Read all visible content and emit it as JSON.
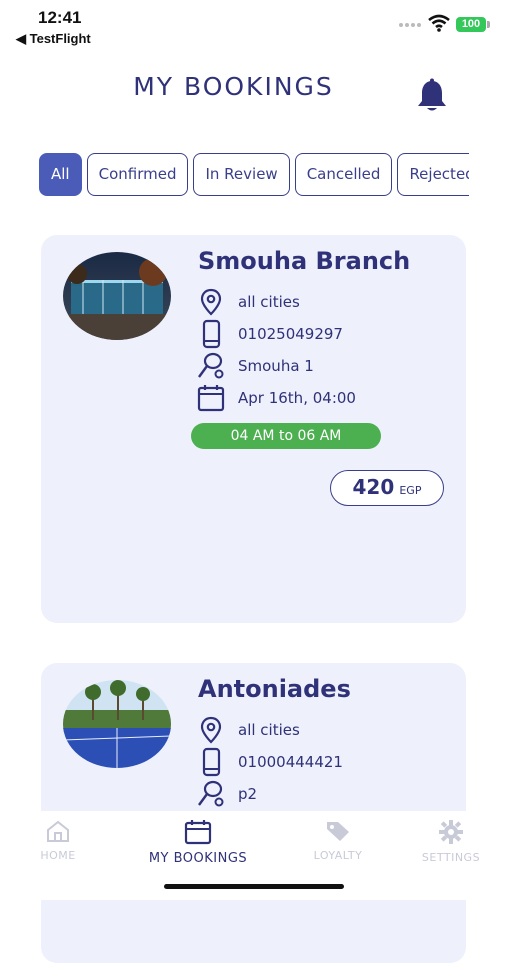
{
  "status_bar": {
    "time": "12:41",
    "back_app": "◀ TestFlight",
    "battery": "100"
  },
  "header": {
    "title": "MY BOOKINGS",
    "bell_icon": "bell-icon"
  },
  "tabs": [
    {
      "label": "All",
      "active": true
    },
    {
      "label": "Confirmed",
      "active": false
    },
    {
      "label": "In Review",
      "active": false
    },
    {
      "label": "Cancelled",
      "active": false
    },
    {
      "label": "Rejected",
      "active": false
    }
  ],
  "bookings": [
    {
      "name": "Smouha Branch",
      "city": "all cities",
      "phone": "01025049297",
      "court": "Smouha 1",
      "date": "Apr 16th, 04:00",
      "time_range": "04 AM to 06 AM",
      "price": "420",
      "currency": "EGP"
    },
    {
      "name": "Antoniades",
      "city": "all cities",
      "phone": "01000444421",
      "court": "p2"
    }
  ],
  "bottom_nav": [
    {
      "label": "HOME",
      "icon": "home-icon",
      "active": false
    },
    {
      "label": "MY BOOKINGS",
      "icon": "calendar-icon",
      "active": true
    },
    {
      "label": "LOYALTY",
      "icon": "tag-icon",
      "active": false
    },
    {
      "label": "SETTINGS",
      "icon": "gear-icon",
      "active": false
    }
  ],
  "colors": {
    "primary": "#2f3278",
    "tab_active": "#4a5cb7",
    "card_bg": "#eef0fc",
    "time_pill": "#4caf50"
  }
}
